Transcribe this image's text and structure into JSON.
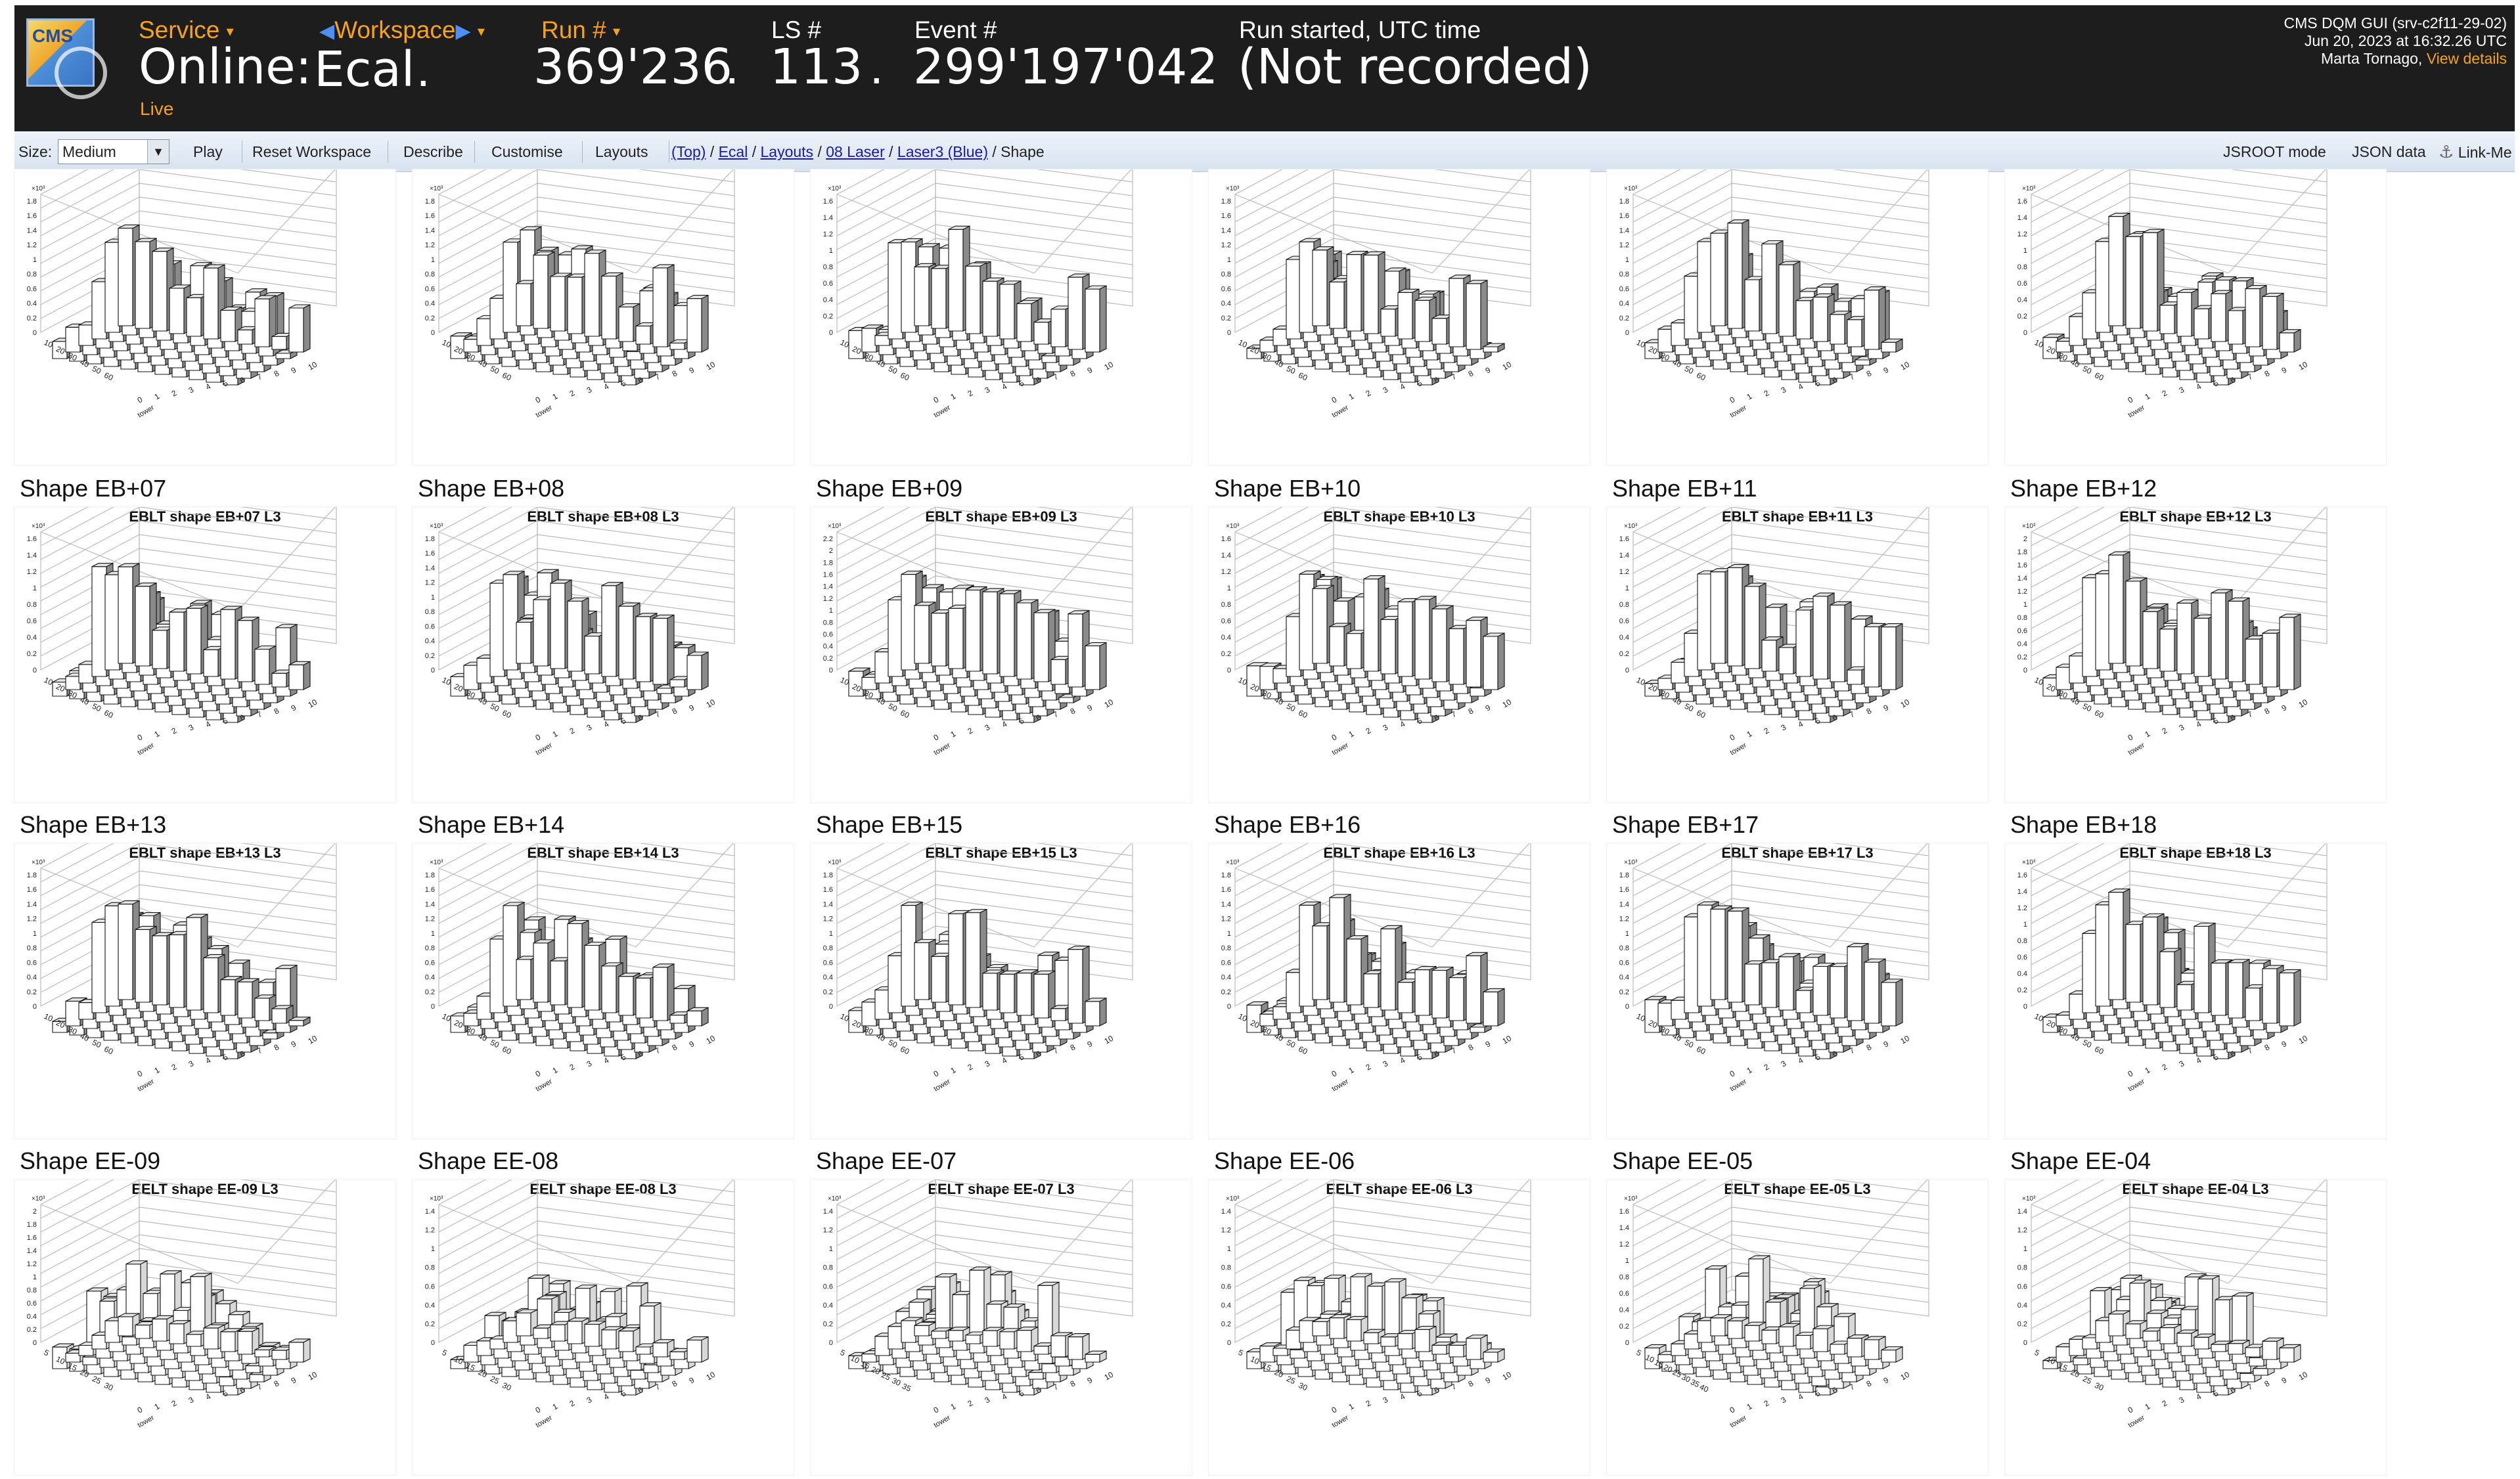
{
  "header": {
    "logo_text": "CMS",
    "service_label": "Service",
    "service_value": "Online:",
    "service_status": "Live",
    "workspace_label": "Workspace",
    "workspace_value": "Ecal",
    "run_label": "Run #",
    "run_value": "369'236",
    "ls_label": "LS #",
    "ls_value": "113",
    "event_label": "Event #",
    "event_value": "299'197'042",
    "time_label": "Run started, UTC time",
    "time_value": "(Not recorded)",
    "gui_name": "CMS DQM GUI (srv-c2f11-29-02)",
    "timestamp": "Jun 20, 2023 at 16:32.26 UTC",
    "user": "Marta Tornago,",
    "view_details": "View details",
    "separator": "."
  },
  "toolbar": {
    "size_label": "Size:",
    "size_value": "Medium",
    "play": "Play",
    "reset_workspace": "Reset Workspace",
    "describe": "Describe",
    "customise": "Customise",
    "layouts": "Layouts",
    "breadcrumb": {
      "top": "(Top)",
      "ecal": "Ecal",
      "layouts": "Layouts",
      "laser": "08 Laser",
      "laser3": "Laser3 (Blue)",
      "current": "Shape",
      "sep": " / "
    },
    "jsroot_mode": "JSROOT mode",
    "json_data": "JSON data",
    "link_me": "Link-Me"
  },
  "plots": {
    "axis_labels": {
      "x": "tower",
      "exponent": "×10³"
    },
    "rows": [
      [
        {
          "title": "",
          "plot_title": "",
          "eta_ticks": [
            "10",
            "20",
            "30",
            "40",
            "50",
            "60"
          ],
          "y_ticks": [
            "0",
            "0.2",
            "0.4",
            "0.6",
            "0.8",
            "1",
            "1.2",
            "1.4",
            "1.6",
            "1.8"
          ]
        },
        {
          "title": "",
          "plot_title": "",
          "eta_ticks": [
            "10",
            "20",
            "30",
            "40",
            "50",
            "60"
          ],
          "y_ticks": [
            "0",
            "0.2",
            "0.4",
            "0.6",
            "0.8",
            "1",
            "1.2",
            "1.4",
            "1.6",
            "1.8"
          ]
        },
        {
          "title": "",
          "plot_title": "",
          "eta_ticks": [
            "10",
            "20",
            "30",
            "40",
            "50",
            "60"
          ],
          "y_ticks": [
            "0",
            "0.2",
            "0.4",
            "0.6",
            "0.8",
            "1",
            "1.2",
            "1.4",
            "1.6"
          ]
        },
        {
          "title": "",
          "plot_title": "",
          "eta_ticks": [
            "10",
            "20",
            "30",
            "40",
            "50",
            "60"
          ],
          "y_ticks": [
            "0",
            "0.2",
            "0.4",
            "0.6",
            "0.8",
            "1",
            "1.2",
            "1.4",
            "1.6",
            "1.8"
          ]
        },
        {
          "title": "",
          "plot_title": "",
          "eta_ticks": [
            "10",
            "20",
            "30",
            "40",
            "50",
            "60"
          ],
          "y_ticks": [
            "0",
            "0.2",
            "0.4",
            "0.6",
            "0.8",
            "1",
            "1.2",
            "1.4",
            "1.6",
            "1.8"
          ]
        },
        {
          "title": "",
          "plot_title": "",
          "eta_ticks": [
            "10",
            "20",
            "30",
            "40",
            "50",
            "60"
          ],
          "y_ticks": [
            "0",
            "0.2",
            "0.4",
            "0.6",
            "0.8",
            "1",
            "1.2",
            "1.4",
            "1.6"
          ]
        }
      ],
      [
        {
          "title": "Shape EB+07",
          "plot_title": "EBLT shape EB+07 L3",
          "eta_ticks": [
            "10",
            "20",
            "30",
            "40",
            "50",
            "60"
          ],
          "y_ticks": [
            "0",
            "0.2",
            "0.4",
            "0.6",
            "0.8",
            "1",
            "1.2",
            "1.4",
            "1.6"
          ]
        },
        {
          "title": "Shape EB+08",
          "plot_title": "EBLT shape EB+08 L3",
          "eta_ticks": [
            "10",
            "20",
            "30",
            "40",
            "50",
            "60"
          ],
          "y_ticks": [
            "0",
            "0.2",
            "0.4",
            "0.6",
            "0.8",
            "1",
            "1.2",
            "1.4",
            "1.6",
            "1.8"
          ]
        },
        {
          "title": "Shape EB+09",
          "plot_title": "EBLT shape EB+09 L3",
          "eta_ticks": [
            "10",
            "20",
            "30",
            "40",
            "50",
            "60"
          ],
          "y_ticks": [
            "0",
            "0.2",
            "0.4",
            "0.6",
            "0.8",
            "1",
            "1.2",
            "1.4",
            "1.6",
            "1.8",
            "2",
            "2.2"
          ]
        },
        {
          "title": "Shape EB+10",
          "plot_title": "EBLT shape EB+10 L3",
          "eta_ticks": [
            "10",
            "20",
            "30",
            "40",
            "50",
            "60"
          ],
          "y_ticks": [
            "0",
            "0.2",
            "0.4",
            "0.6",
            "0.8",
            "1",
            "1.2",
            "1.4",
            "1.6"
          ]
        },
        {
          "title": "Shape EB+11",
          "plot_title": "EBLT shape EB+11 L3",
          "eta_ticks": [
            "10",
            "20",
            "30",
            "40",
            "50",
            "60"
          ],
          "y_ticks": [
            "0",
            "0.2",
            "0.4",
            "0.6",
            "0.8",
            "1",
            "1.2",
            "1.4",
            "1.6"
          ]
        },
        {
          "title": "Shape EB+12",
          "plot_title": "EBLT shape EB+12 L3",
          "eta_ticks": [
            "10",
            "20",
            "30",
            "40",
            "50",
            "60"
          ],
          "y_ticks": [
            "0",
            "0.2",
            "0.4",
            "0.6",
            "0.8",
            "1",
            "1.2",
            "1.4",
            "1.6",
            "1.8",
            "2"
          ]
        }
      ],
      [
        {
          "title": "Shape EB+13",
          "plot_title": "EBLT shape EB+13 L3",
          "eta_ticks": [
            "10",
            "20",
            "30",
            "40",
            "50",
            "60"
          ],
          "y_ticks": [
            "0",
            "0.2",
            "0.4",
            "0.6",
            "0.8",
            "1",
            "1.2",
            "1.4",
            "1.6",
            "1.8"
          ]
        },
        {
          "title": "Shape EB+14",
          "plot_title": "EBLT shape EB+14 L3",
          "eta_ticks": [
            "10",
            "20",
            "30",
            "40",
            "50",
            "60"
          ],
          "y_ticks": [
            "0",
            "0.2",
            "0.4",
            "0.6",
            "0.8",
            "1",
            "1.2",
            "1.4",
            "1.6",
            "1.8"
          ]
        },
        {
          "title": "Shape EB+15",
          "plot_title": "EBLT shape EB+15 L3",
          "eta_ticks": [
            "10",
            "20",
            "30",
            "40",
            "50",
            "60"
          ],
          "y_ticks": [
            "0",
            "0.2",
            "0.4",
            "0.6",
            "0.8",
            "1",
            "1.2",
            "1.4",
            "1.6",
            "1.8"
          ]
        },
        {
          "title": "Shape EB+16",
          "plot_title": "EBLT shape EB+16 L3",
          "eta_ticks": [
            "10",
            "20",
            "30",
            "40",
            "50",
            "60"
          ],
          "y_ticks": [
            "0",
            "0.2",
            "0.4",
            "0.6",
            "0.8",
            "1",
            "1.2",
            "1.4",
            "1.6",
            "1.8"
          ]
        },
        {
          "title": "Shape EB+17",
          "plot_title": "EBLT shape EB+17 L3",
          "eta_ticks": [
            "10",
            "20",
            "30",
            "40",
            "50",
            "60"
          ],
          "y_ticks": [
            "0",
            "0.2",
            "0.4",
            "0.6",
            "0.8",
            "1",
            "1.2",
            "1.4",
            "1.6",
            "1.8"
          ]
        },
        {
          "title": "Shape EB+18",
          "plot_title": "EBLT shape EB+18 L3",
          "eta_ticks": [
            "10",
            "20",
            "30",
            "40",
            "50",
            "60"
          ],
          "y_ticks": [
            "0",
            "0.2",
            "0.4",
            "0.6",
            "0.8",
            "1",
            "1.2",
            "1.4",
            "1.6"
          ]
        }
      ],
      [
        {
          "title": "Shape EE-09",
          "plot_title": "EELT shape EE-09 L3",
          "eta_ticks": [
            "5",
            "10",
            "15",
            "20",
            "25",
            "30"
          ],
          "y_ticks": [
            "0",
            "0.2",
            "0.4",
            "0.6",
            "0.8",
            "1",
            "1.2",
            "1.4",
            "1.6",
            "1.8",
            "2"
          ]
        },
        {
          "title": "Shape EE-08",
          "plot_title": "EELT shape EE-08 L3",
          "eta_ticks": [
            "5",
            "10",
            "15",
            "20",
            "25",
            "30"
          ],
          "y_ticks": [
            "0",
            "0.2",
            "0.4",
            "0.6",
            "0.8",
            "1",
            "1.2",
            "1.4"
          ]
        },
        {
          "title": "Shape EE-07",
          "plot_title": "EELT shape EE-07 L3",
          "eta_ticks": [
            "5",
            "10",
            "15",
            "20",
            "25",
            "30",
            "35"
          ],
          "y_ticks": [
            "0",
            "0.2",
            "0.4",
            "0.6",
            "0.8",
            "1",
            "1.2",
            "1.4"
          ]
        },
        {
          "title": "Shape EE-06",
          "plot_title": "EELT shape EE-06 L3",
          "eta_ticks": [
            "5",
            "10",
            "15",
            "20",
            "25",
            "30"
          ],
          "y_ticks": [
            "0",
            "0.2",
            "0.4",
            "0.6",
            "0.8",
            "1",
            "1.2",
            "1.4"
          ]
        },
        {
          "title": "Shape EE-05",
          "plot_title": "EELT shape EE-05 L3",
          "eta_ticks": [
            "5",
            "10",
            "15",
            "20",
            "25",
            "30",
            "35",
            "40"
          ],
          "y_ticks": [
            "0",
            "0.2",
            "0.4",
            "0.6",
            "0.8",
            "1",
            "1.2",
            "1.4",
            "1.6"
          ]
        },
        {
          "title": "Shape EE-04",
          "plot_title": "EELT shape EE-04 L3",
          "eta_ticks": [
            "5",
            "10",
            "15",
            "20",
            "25",
            "30"
          ],
          "y_ticks": [
            "0",
            "0.2",
            "0.4",
            "0.6",
            "0.8",
            "1",
            "1.2",
            "1.4"
          ]
        }
      ]
    ],
    "tower_ticks": [
      "0",
      "1",
      "2",
      "3",
      "4",
      "5",
      "6",
      "7",
      "8",
      "9",
      "10"
    ]
  },
  "colors": {
    "header_bg": "#1d1d1d",
    "accent_orange": "#f6a21a",
    "toolbar_bg": "#dde6f2",
    "link": "#1a1aa6",
    "bar_front": "#ffffff",
    "bar_side": "#8a8a8a",
    "bar_top": "#dcdcdc"
  }
}
